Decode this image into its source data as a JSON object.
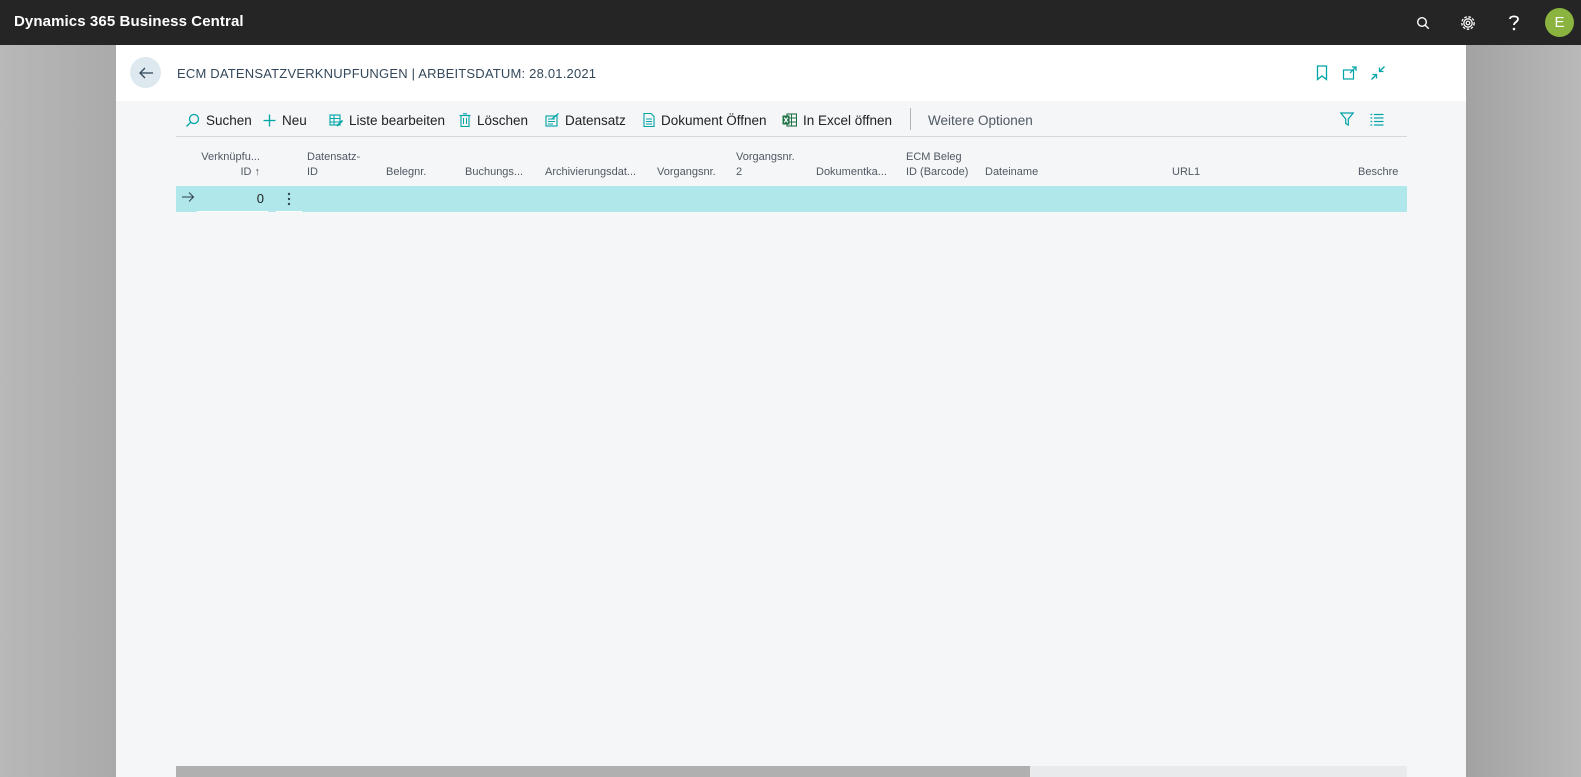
{
  "app": {
    "title": "Dynamics 365 Business Central",
    "avatar_initial": "E"
  },
  "topbar_icons": [
    "search-icon",
    "gear-icon",
    "help-icon"
  ],
  "page": {
    "title": "ECM DATENSATZVERKNUPFUNGEN | ARBEITSDATUM: 28.01.2021"
  },
  "actions": {
    "search": "Suchen",
    "new": "Neu",
    "edit_list": "Liste bearbeiten",
    "delete": "Löschen",
    "record": "Datensatz",
    "open_document": "Dokument Öffnen",
    "open_excel": "In Excel öffnen",
    "more": "Weitere Optionen"
  },
  "columns": {
    "link_id_1": "Verknüpfu...",
    "link_id_2": "ID ↑",
    "record_id_1": "Datensatz-",
    "record_id_2": "ID",
    "document_no": "Belegnr.",
    "posting": "Buchungs...",
    "archive_date": "Archivierungsdat...",
    "process_no": "Vorgangsnr.",
    "process_no2_1": "Vorgangsnr.",
    "process_no2_2": "2",
    "doc_category": "Dokumentka...",
    "ecm_barcode_1": "ECM Beleg",
    "ecm_barcode_2": "ID (Barcode)",
    "file_name": "Dateiname",
    "url1": "URL1",
    "description": "Beschre"
  },
  "rows": [
    {
      "link_id": "0"
    }
  ],
  "colors": {
    "accent": "#00a4a7",
    "selected_row": "#b0e7ea",
    "topbar": "#252525",
    "avatar": "#8ab43f"
  }
}
